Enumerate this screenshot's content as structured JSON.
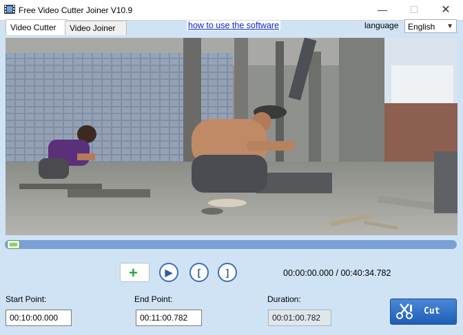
{
  "window": {
    "title": "Free Video Cutter Joiner V10.9",
    "controls": {
      "minimize": "—",
      "maximize": "☐",
      "close": "✕"
    }
  },
  "tabs": [
    {
      "label": "Video Cutter",
      "active": true
    },
    {
      "label": "Video Joiner",
      "active": false
    }
  ],
  "help_link": "how to use the software",
  "language": {
    "label": "language",
    "selected": "English"
  },
  "playback": {
    "progress_fraction": 0.0,
    "current_time": "00:00:00.000",
    "separator": "/",
    "total_time": "00:40:34.782"
  },
  "buttons": {
    "add": "+",
    "play": "▶",
    "mark_start": "[",
    "mark_end": "]",
    "cut": "Cut"
  },
  "fields": {
    "start_label": "Start Point:",
    "start_value": "00:10:00.000",
    "end_label": "End Point:",
    "end_value": "00:11:00.782",
    "duration_label": "Duration:",
    "duration_value": "00:01:00.782"
  },
  "colors": {
    "background": "#cfe3f5",
    "progress_bar": "#7aa1d6",
    "link": "#0b22ce",
    "cut_button": "#2a6cc2",
    "add_icon": "#2da440"
  }
}
